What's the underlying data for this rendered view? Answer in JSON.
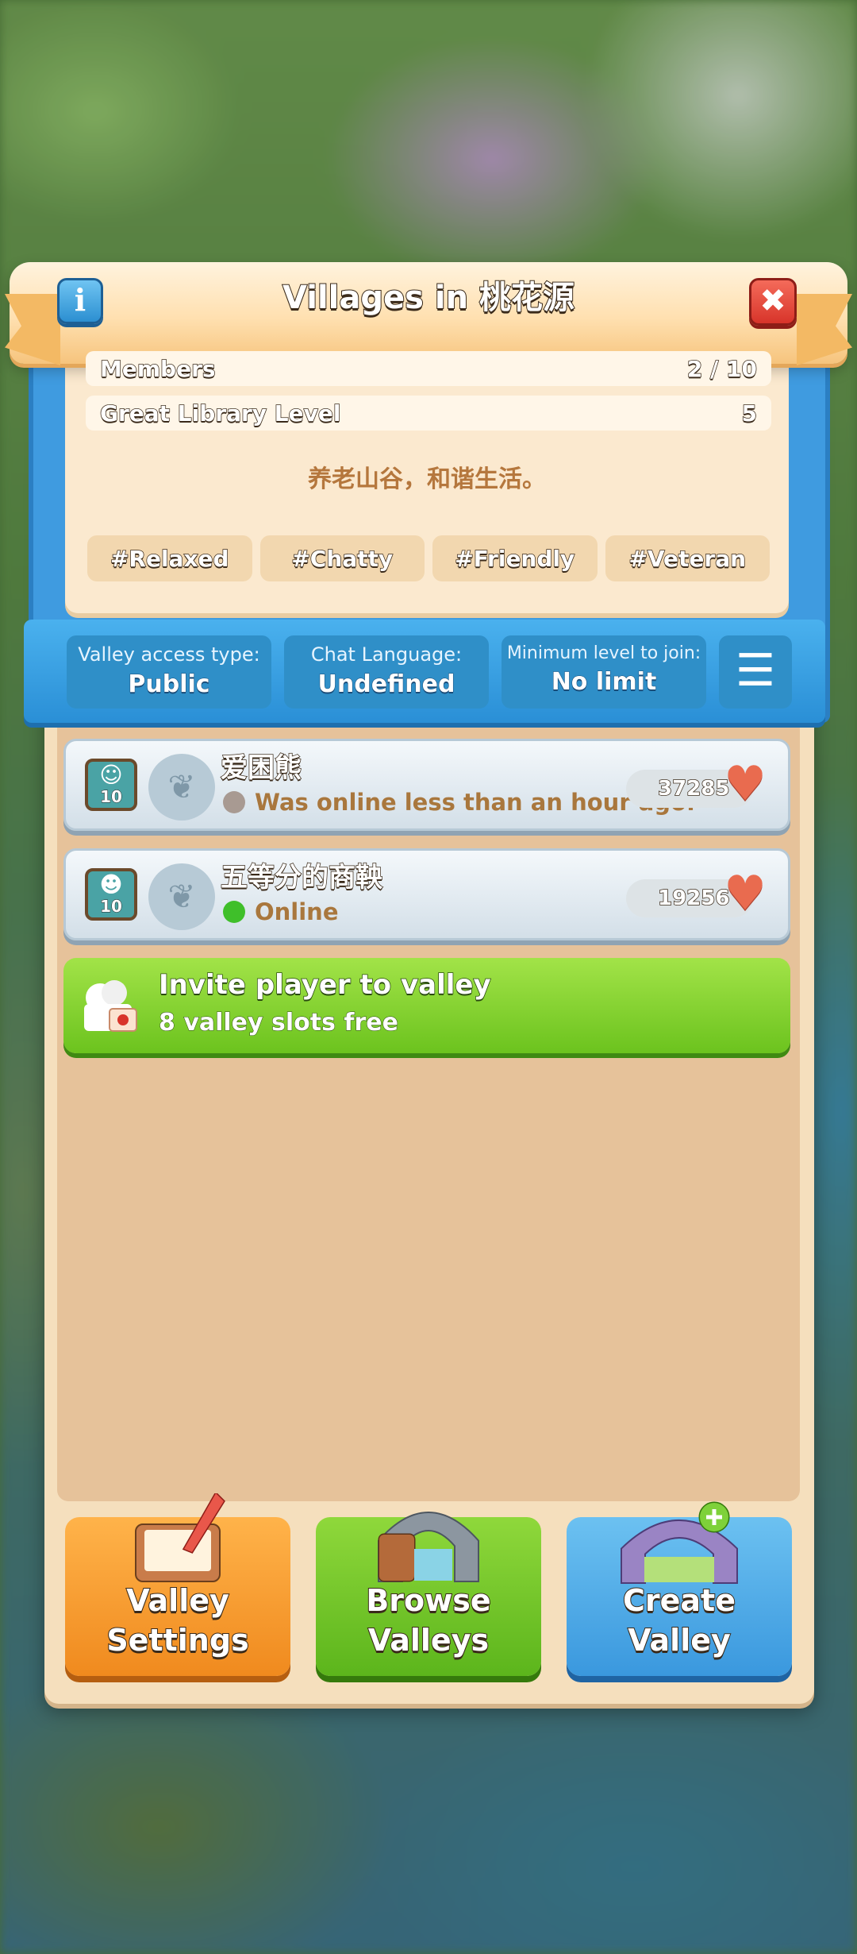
{
  "header": {
    "title": "Villages in 桃花源",
    "info_icon": "info-icon",
    "close_icon": "close-icon"
  },
  "info": {
    "rows": [
      {
        "label": "Members",
        "value": "2 / 10"
      },
      {
        "label": "Great Library Level",
        "value": "5"
      }
    ],
    "motto": "养老山谷，和谐生活。",
    "tags": [
      "#Relaxed",
      "#Chatty",
      "#Friendly",
      "#Veteran"
    ]
  },
  "settings": {
    "stats": [
      {
        "label": "Valley access type:",
        "value": "Public"
      },
      {
        "label": "Chat Language:",
        "value": "Undefined"
      },
      {
        "label": "Minimum level to join:",
        "value": "No limit"
      }
    ],
    "list_icon": "list-add-icon"
  },
  "members": [
    {
      "level": "10",
      "name": "爱困熊",
      "status": "Was online less than an hour ago.",
      "status_color": "#a89a92",
      "score": "37285"
    },
    {
      "level": "10",
      "name": "五等分的商鞅",
      "status": "Online",
      "status_color": "#3fbf2a",
      "score": "19256"
    }
  ],
  "invite": {
    "title": "Invite player to valley",
    "subtitle": "8 valley slots free"
  },
  "buttons": {
    "settings": "Valley\nSettings",
    "browse": "Browse\nValleys",
    "create": "Create Valley"
  },
  "colors": {
    "accent_blue": "#3a98de",
    "green": "#6cc31e",
    "orange": "#f08a1e",
    "heart": "#e96b4f"
  }
}
